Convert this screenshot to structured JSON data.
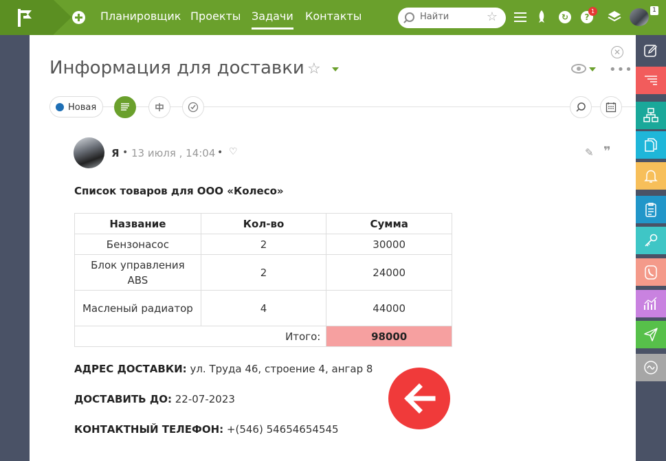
{
  "topbar": {
    "nav": [
      "Планировщик",
      "Проекты",
      "Задачи",
      "Контакты"
    ],
    "active_nav": "Задачи",
    "search_placeholder": "Найти",
    "help_badge": "1",
    "profile_badge": "1"
  },
  "task": {
    "title": "Информация для доставки",
    "status": "Новая"
  },
  "post": {
    "author": "Я",
    "date": "13 июля , 14:04"
  },
  "content": {
    "list_title": "Список товаров для ООО «Колесо»",
    "table": {
      "headers": [
        "Название",
        "Кол-во",
        "Сумма"
      ],
      "rows": [
        [
          "Бензонасос",
          "2",
          "30000"
        ],
        [
          "Блок управления ABS",
          "2",
          "24000"
        ],
        [
          "Масленый радиатор",
          "4",
          "44000"
        ]
      ],
      "total_label": "Итого:",
      "total_value": "98000"
    },
    "address_label": "АДРЕС ДОСТАВКИ:",
    "address_value": "ул. Труда 46, строение 4, ангар 8",
    "deliver_label": "ДОСТАВИТЬ ДО:",
    "deliver_value": "22-07-2023",
    "phone_label": "КОНТАКТНЫЙ ТЕЛЕФОН:",
    "phone_value": "+(546) 54654654545"
  },
  "colors": {
    "brand_green": "#6aa02c",
    "total_highlight": "#f6a0a0",
    "back_button": "#f03a3a",
    "sidebar": [
      "#4a5266",
      "#f25c5c",
      "#1aa89a",
      "#1fb6d9",
      "#f7bf5a",
      "#2196c9",
      "#3fc6c6",
      "#f49a8a",
      "#c982e0",
      "#57c04a",
      "#a6a6a6"
    ]
  },
  "icons": {
    "sidebar": [
      "edit-icon",
      "list-icon",
      "structure-icon",
      "documents-icon",
      "bell-icon",
      "clipboard-icon",
      "key-icon",
      "phone-icon",
      "chart-icon",
      "send-icon",
      "wave-icon"
    ]
  }
}
